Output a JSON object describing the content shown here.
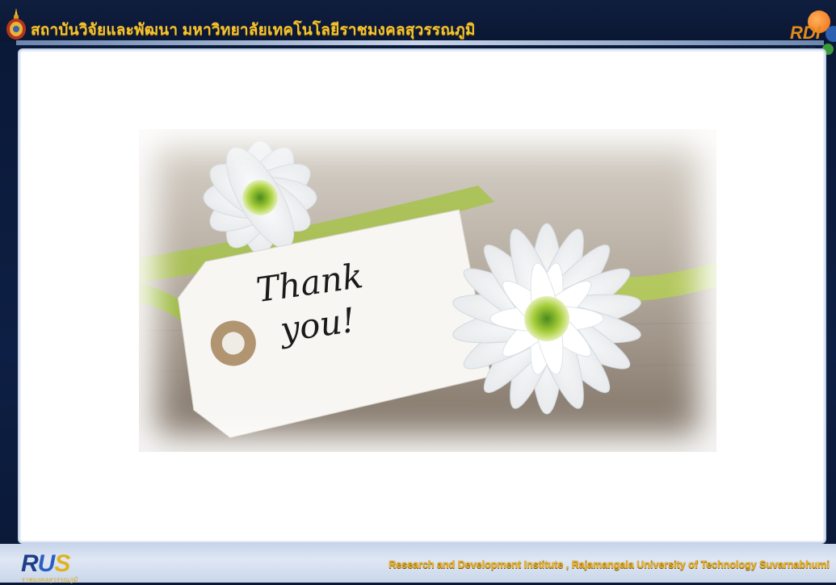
{
  "header": {
    "title": "สถาบันวิจัยและพัฒนา  มหาวิทยาลัยเทคโนโลยีราชมงคลสุวรรณภูมิ",
    "logo_text": "RDI",
    "logo_sub": "RUS",
    "crest_icon": "university-crest-icon"
  },
  "slide": {
    "tag_text_line1": "Thank",
    "tag_text_line2": "you!"
  },
  "footer": {
    "logo_r": "R",
    "logo_u": "U",
    "logo_s": "S",
    "logo_sub": "ราชมงคลสุวรรณภูมิ",
    "caption": "Research and Development Institute , Rajamangala University of Technology Suvarnabhumi"
  },
  "colors": {
    "header_bg": "#0a1733",
    "title_gold": "#f6c431",
    "panel_bg": "#ffffff",
    "footer_bg": "#d3ddef",
    "caption_gold": "#f0b320"
  }
}
